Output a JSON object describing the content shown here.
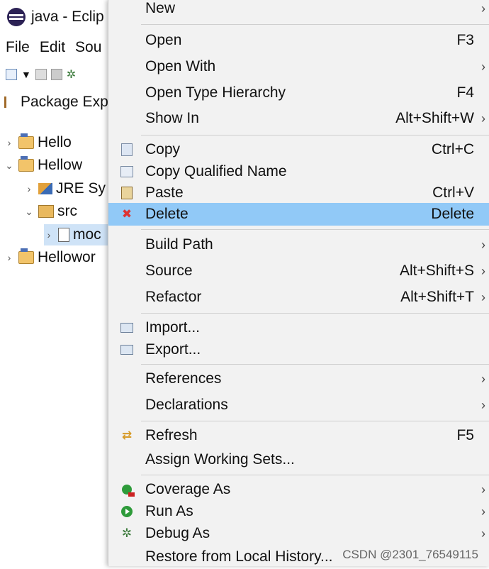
{
  "window": {
    "title": "java - Eclip"
  },
  "menubar": [
    "File",
    "Edit",
    "Sou"
  ],
  "view": {
    "tab_label": "Package Exp"
  },
  "tree": [
    {
      "label": "Hello",
      "expanded": false
    },
    {
      "label": "Hellow",
      "expanded": true
    },
    {
      "label": "JRE Sy",
      "expanded": false
    },
    {
      "label": "src",
      "expanded": true
    },
    {
      "label": "moc",
      "expanded": false
    },
    {
      "label": "Hellowor",
      "expanded": false
    }
  ],
  "context_menu": {
    "items": [
      {
        "label": "New",
        "accel": "",
        "submenu": true
      },
      {
        "label": "Open",
        "accel": "F3",
        "submenu": false
      },
      {
        "label": "Open With",
        "accel": "",
        "submenu": true
      },
      {
        "label": "Open Type Hierarchy",
        "accel": "F4",
        "submenu": false
      },
      {
        "label": "Show In",
        "accel": "Alt+Shift+W",
        "submenu": true
      },
      {
        "label": "Copy",
        "accel": "Ctrl+C",
        "submenu": false
      },
      {
        "label": "Copy Qualified Name",
        "accel": "",
        "submenu": false
      },
      {
        "label": "Paste",
        "accel": "Ctrl+V",
        "submenu": false
      },
      {
        "label": "Delete",
        "accel": "Delete",
        "submenu": false,
        "highlighted": true
      },
      {
        "label": "Build Path",
        "accel": "",
        "submenu": true
      },
      {
        "label": "Source",
        "accel": "Alt+Shift+S",
        "submenu": true
      },
      {
        "label": "Refactor",
        "accel": "Alt+Shift+T",
        "submenu": true
      },
      {
        "label": "Import...",
        "accel": "",
        "submenu": false
      },
      {
        "label": "Export...",
        "accel": "",
        "submenu": false
      },
      {
        "label": "References",
        "accel": "",
        "submenu": true
      },
      {
        "label": "Declarations",
        "accel": "",
        "submenu": true
      },
      {
        "label": "Refresh",
        "accel": "F5",
        "submenu": false
      },
      {
        "label": "Assign Working Sets...",
        "accel": "",
        "submenu": false
      },
      {
        "label": "Coverage As",
        "accel": "",
        "submenu": true
      },
      {
        "label": "Run As",
        "accel": "",
        "submenu": true
      },
      {
        "label": "Debug As",
        "accel": "",
        "submenu": true
      },
      {
        "label": "Restore from Local History...",
        "accel": "",
        "submenu": false
      }
    ],
    "highlight_color": "#91c9f7"
  },
  "watermark": "CSDN @2301_76549115",
  "submenu_glyph": "›"
}
